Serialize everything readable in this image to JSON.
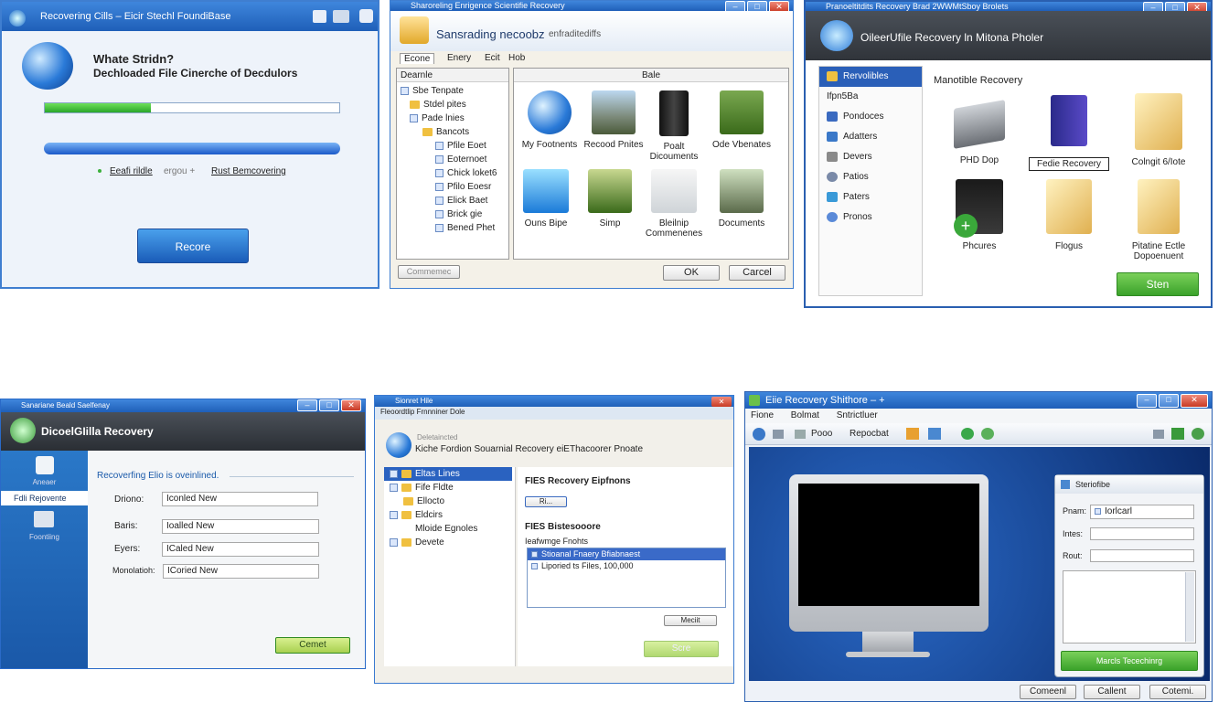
{
  "w1": {
    "title": "Recovering Cills – Eicir Stechl FoundiBase",
    "heading": "Whate Stridn?",
    "subheading": "Dechloaded File Cinerche of Decdulors",
    "progress": 0.36,
    "link1": "Eeafi rildle",
    "mid": "ergou +",
    "link2": "Rust Bemcovering",
    "button": "Recore"
  },
  "w2": {
    "title": "Sharoreling Enrigence Scientifie Recovery",
    "heading": "Sansrading necoobz",
    "subhead": "enfraditediffs",
    "menu": [
      "Econe",
      "Enery",
      "Ecit",
      "Hob"
    ],
    "tree_header": "Dearnle",
    "content_header": "Bale",
    "tree": [
      "Sbe Tenpate",
      "Stdel pites",
      "Pade lnies",
      "Bancots",
      "Pfile Eoet",
      "Eoternoet",
      "Chick loket6",
      "Pfilo Eoesr",
      "Elick Baet",
      "Brick gie",
      "Bened Phet"
    ],
    "tiles": [
      "My Footnents",
      "Recood Pnites",
      "Poalt Dicouments",
      "Ode Vbenates",
      "Ouns Bipe",
      "Simp",
      "Bleilnip Commenenes",
      "Documents"
    ],
    "left_button": "Commemec",
    "ok": "OK",
    "cancel": "Carcel"
  },
  "w3": {
    "title": "Pranoeltitdits Recovery Brad 2WWMtSboy Brolets",
    "header": "OileerUfile Recovery ln Mitona Pholer",
    "side": [
      "Rervolibles",
      "Ifpn5Ba",
      "Pondoces",
      "Adatters",
      "Devers",
      "Patios",
      "Paters",
      "Pronos"
    ],
    "heading": "Manotible Recovery",
    "tiles": [
      "PHD Dop",
      "Fedie Recovery",
      "Colngit 6/Iote",
      "Phcures",
      "Flogus",
      "Pitatine Ectle Dopoenuent"
    ],
    "button": "Sten"
  },
  "w4": {
    "title": "Sanariane Beald Saelfenay",
    "header": "DicoelGIilla Recovery",
    "side_top": "Aneaer",
    "side_sel": "Fdli Rejovente",
    "side_bot": "Foontiing",
    "heading": "Recoverfing Elio is oveinlined.",
    "labels": [
      "Driono:",
      "Baris:",
      "Eyers:",
      "Monolatioh:"
    ],
    "values": [
      "Iconled New",
      "Ioalled New",
      "ICaled New",
      "ICoried New"
    ],
    "button": "Cemet"
  },
  "w5": {
    "title": "Sionret Hile",
    "subtitle": "Fleoordtlip Frnnniner Dole",
    "banner_small": "Deletaincted",
    "header": "Kiche Fordion Souarnial Recovery eiEThacoorer Pnoate",
    "tree": [
      "Eltas Lines",
      "Fife Fldte",
      "Ellocto",
      "Eldcirs",
      "Mloide Egnoles",
      "Devete"
    ],
    "title2": "FIES Recovery Eipfnons",
    "btn_small": "Ri...",
    "title3": "FIES Bistesooore",
    "lbl": "Ieafwmge Fnohts",
    "list": [
      "Stioanal Fnaery Bfiabnaest",
      "Liporied ts Files, 100,000"
    ],
    "btn_mid": "Meciit",
    "btn_green": "Scre"
  },
  "w6": {
    "title": "Eiie Recovery Shithore – +",
    "menu": [
      "Fione",
      "Bolmat",
      "Sntrictluer"
    ],
    "toolbar": [
      "Pooo",
      "Repocbat"
    ],
    "panel_title": "Steriofibe",
    "labels": [
      "Pnam:",
      "Intes:",
      "Rout:"
    ],
    "value": "Iorlcarl",
    "button_green": "Marcls Tecechinrg",
    "buttons": [
      "Comeenl",
      "Callent",
      "Cotemi."
    ]
  }
}
